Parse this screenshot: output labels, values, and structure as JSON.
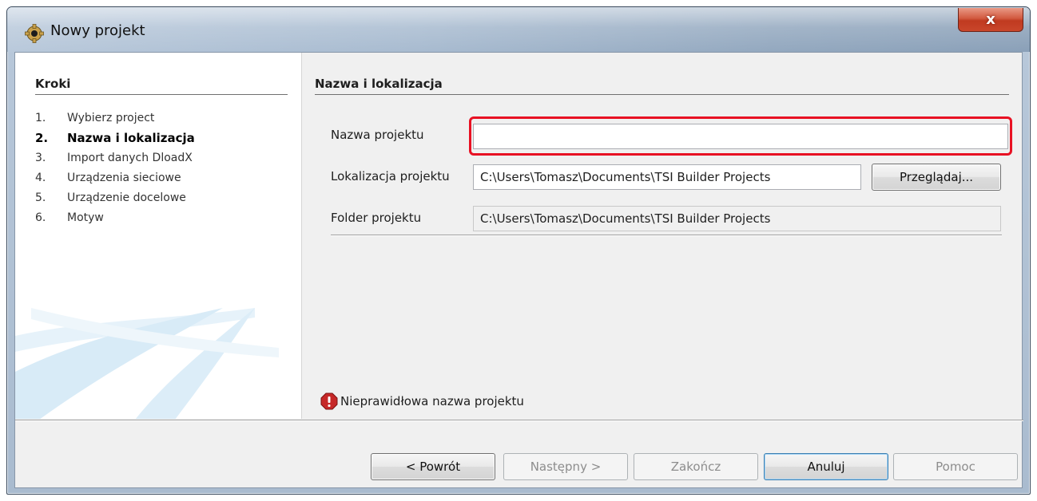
{
  "window": {
    "title": "Nowy projekt",
    "close_label": "x"
  },
  "steps": {
    "heading": "Kroki",
    "items": [
      {
        "num": "1.",
        "label": "Wybierz project"
      },
      {
        "num": "2.",
        "label": "Nazwa i lokalizacja"
      },
      {
        "num": "3.",
        "label": "Import danych DloadX"
      },
      {
        "num": "4.",
        "label": "Urządzenia sieciowe"
      },
      {
        "num": "5.",
        "label": "Urządzenie docelowe"
      },
      {
        "num": "6.",
        "label": "Motyw"
      }
    ],
    "active_index": 1
  },
  "main": {
    "heading": "Nazwa i lokalizacja",
    "project_name": {
      "label": "Nazwa projektu",
      "value": ""
    },
    "project_location": {
      "label": "Lokalizacja projektu",
      "value": "C:\\Users\\Tomasz\\Documents\\TSI Builder Projects"
    },
    "browse_label": "Przeglądaj...",
    "project_folder": {
      "label": "Folder projektu",
      "value": "C:\\Users\\Tomasz\\Documents\\TSI Builder Projects"
    },
    "error_message": "Nieprawidłowa nazwa projektu"
  },
  "footer": {
    "back_label": "< Powrót",
    "next_label": "Następny >",
    "finish_label": "Zakończ",
    "cancel_label": "Anuluj",
    "help_label": "Pomoc"
  },
  "colors": {
    "highlight": "#e81123",
    "error_icon": "#c62828",
    "close_button": "#c9462b"
  },
  "icons": {
    "app": "gear-icon",
    "close": "close-icon",
    "error": "error-icon"
  }
}
